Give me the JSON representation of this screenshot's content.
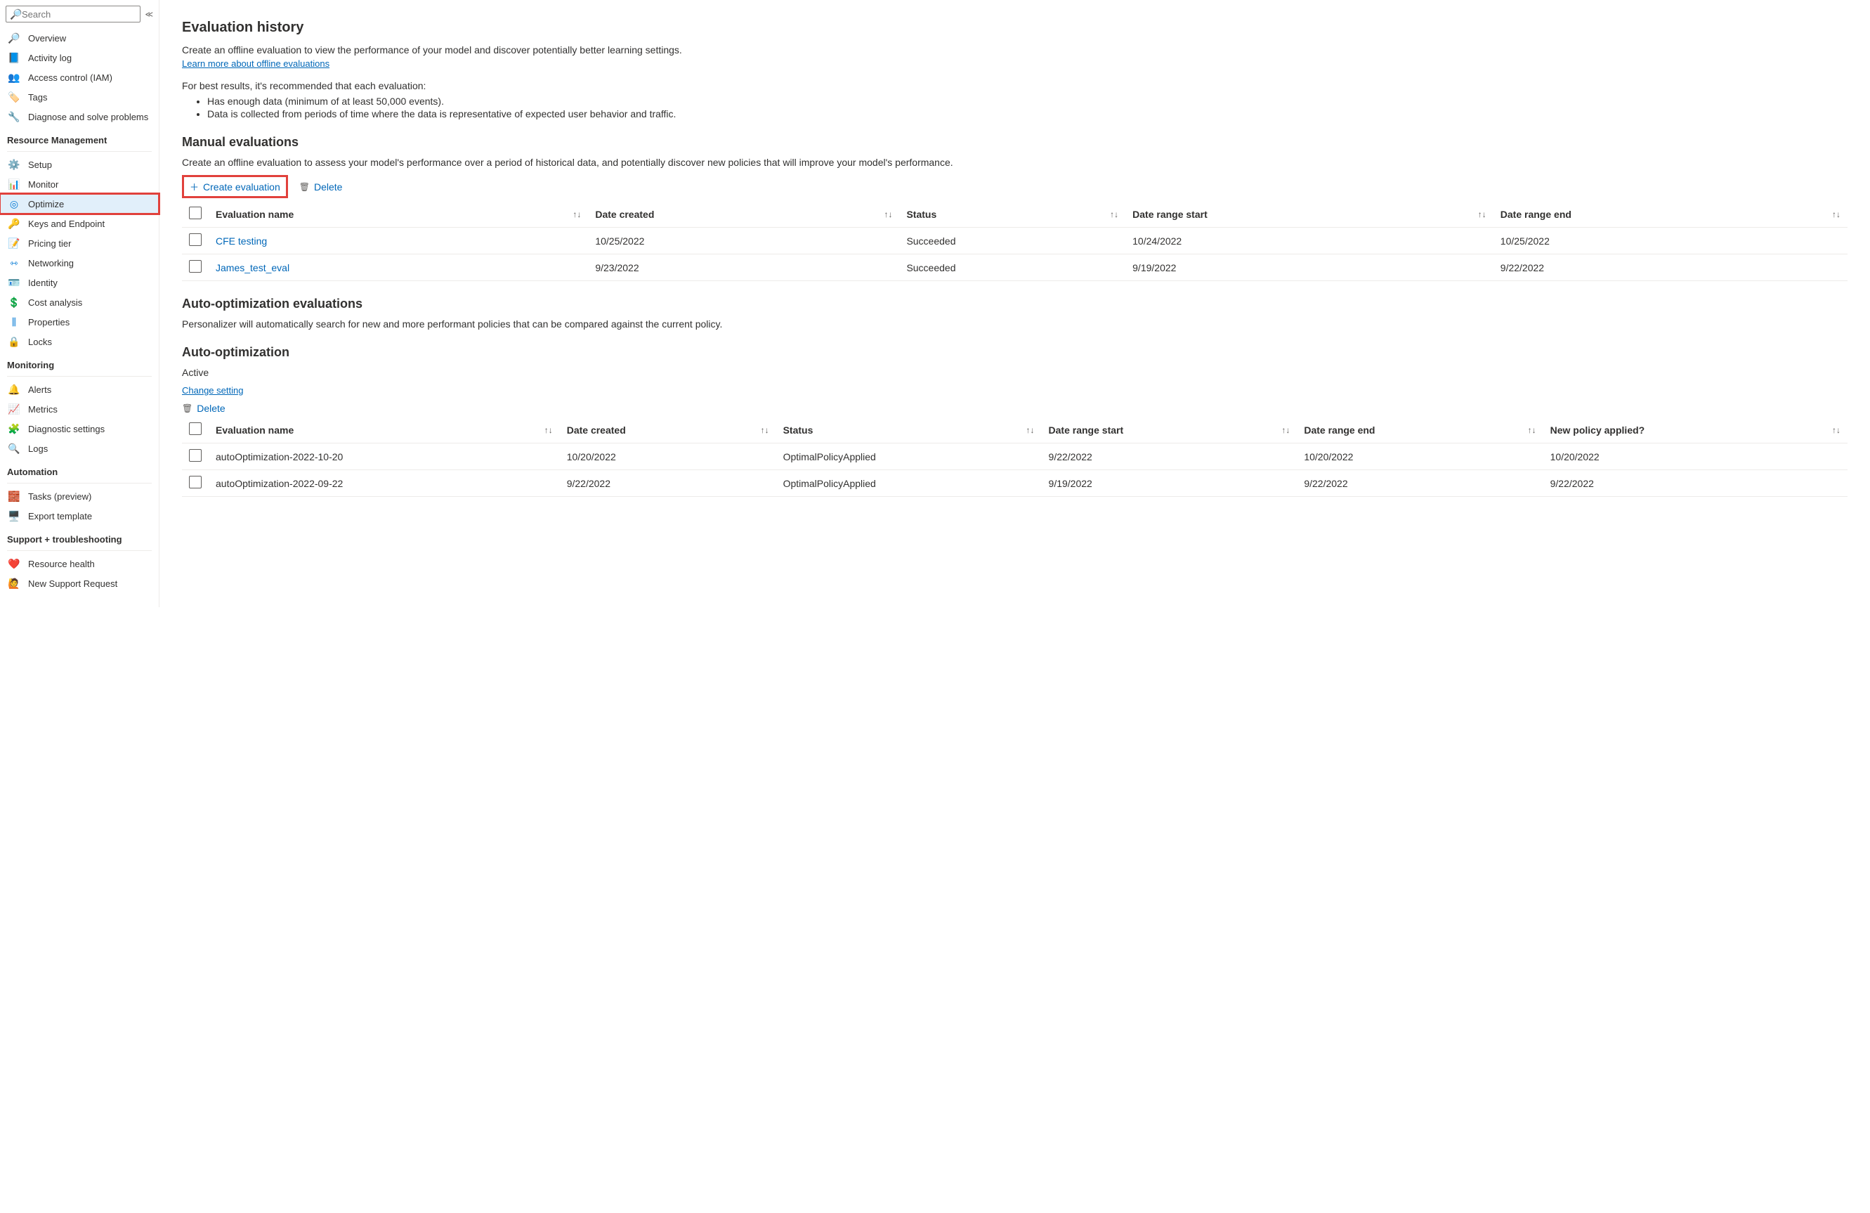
{
  "search": {
    "placeholder": "Search"
  },
  "sidebar": {
    "top": [
      {
        "icon": "🔎",
        "label": "Overview",
        "color": "#0078d4"
      },
      {
        "icon": "📘",
        "label": "Activity log",
        "color": "#0078d4"
      },
      {
        "icon": "👥",
        "label": "Access control (IAM)",
        "color": "#0078d4"
      },
      {
        "icon": "🏷️",
        "label": "Tags",
        "color": "#7b4fb3"
      },
      {
        "icon": "🔧",
        "label": "Diagnose and solve problems",
        "color": "#605e5c"
      }
    ],
    "sections": [
      {
        "title": "Resource Management",
        "items": [
          {
            "icon": "⚙️",
            "label": "Setup",
            "color": "#d18f00"
          },
          {
            "icon": "📊",
            "label": "Monitor",
            "color": "#7b4fb3"
          },
          {
            "icon": "◎",
            "label": "Optimize",
            "color": "#0078d4",
            "active": true,
            "highlighted": true
          },
          {
            "icon": "🔑",
            "label": "Keys and Endpoint",
            "color": "#d18f00"
          },
          {
            "icon": "📝",
            "label": "Pricing tier",
            "color": "#0078d4"
          },
          {
            "icon": "⇿",
            "label": "Networking",
            "color": "#0078d4"
          },
          {
            "icon": "🪪",
            "label": "Identity",
            "color": "#0078d4"
          },
          {
            "icon": "💲",
            "label": "Cost analysis",
            "color": "#107c10"
          },
          {
            "icon": "⫼",
            "label": "Properties",
            "color": "#0078d4"
          },
          {
            "icon": "🔒",
            "label": "Locks",
            "color": "#0078d4"
          }
        ]
      },
      {
        "title": "Monitoring",
        "items": [
          {
            "icon": "🔔",
            "label": "Alerts",
            "color": "#107c10"
          },
          {
            "icon": "📈",
            "label": "Metrics",
            "color": "#0078d4"
          },
          {
            "icon": "🧩",
            "label": "Diagnostic settings",
            "color": "#107c10"
          },
          {
            "icon": "🔍",
            "label": "Logs",
            "color": "#0078d4"
          }
        ]
      },
      {
        "title": "Automation",
        "items": [
          {
            "icon": "🧱",
            "label": "Tasks (preview)",
            "color": "#0078d4"
          },
          {
            "icon": "🖥️",
            "label": "Export template",
            "color": "#0078d4"
          }
        ]
      },
      {
        "title": "Support + troubleshooting",
        "items": [
          {
            "icon": "❤️",
            "label": "Resource health",
            "color": "#605e5c"
          },
          {
            "icon": "🙋",
            "label": "New Support Request",
            "color": "#0078d4"
          }
        ]
      }
    ]
  },
  "evalHistory": {
    "title": "Evaluation history",
    "desc": "Create an offline evaluation to view the performance of your model and discover potentially better learning settings.",
    "learnMore": "Learn more about offline evaluations",
    "tipsIntro": "For best results, it's recommended that each evaluation:",
    "tips": [
      "Has enough data (minimum of at least 50,000 events).",
      "Data is collected from periods of time where the data is representative of expected user behavior and traffic."
    ]
  },
  "manual": {
    "title": "Manual evaluations",
    "desc": "Create an offline evaluation to assess your model's performance over a period of historical data, and potentially discover new policies that will improve your model's performance.",
    "createLabel": "Create evaluation",
    "deleteLabel": "Delete",
    "columns": [
      "Evaluation name",
      "Date created",
      "Status",
      "Date range start",
      "Date range end"
    ],
    "rows": [
      {
        "name": "CFE testing",
        "created": "10/25/2022",
        "status": "Succeeded",
        "start": "10/24/2022",
        "end": "10/25/2022"
      },
      {
        "name": "James_test_eval",
        "created": "9/23/2022",
        "status": "Succeeded",
        "start": "9/19/2022",
        "end": "9/22/2022"
      }
    ]
  },
  "autoEval": {
    "title": "Auto-optimization evaluations",
    "desc": "Personalizer will automatically search for new and more performant policies that can be compared against the current policy."
  },
  "autoOpt": {
    "title": "Auto-optimization",
    "status": "Active",
    "changeSetting": "Change setting",
    "deleteLabel": "Delete",
    "columns": [
      "Evaluation name",
      "Date created",
      "Status",
      "Date range start",
      "Date range end",
      "New policy applied?"
    ],
    "rows": [
      {
        "name": "autoOptimization-2022-10-20",
        "created": "10/20/2022",
        "status": "OptimalPolicyApplied",
        "start": "9/22/2022",
        "end": "10/20/2022",
        "npa": "10/20/2022"
      },
      {
        "name": "autoOptimization-2022-09-22",
        "created": "9/22/2022",
        "status": "OptimalPolicyApplied",
        "start": "9/19/2022",
        "end": "9/22/2022",
        "npa": "9/22/2022"
      }
    ]
  }
}
